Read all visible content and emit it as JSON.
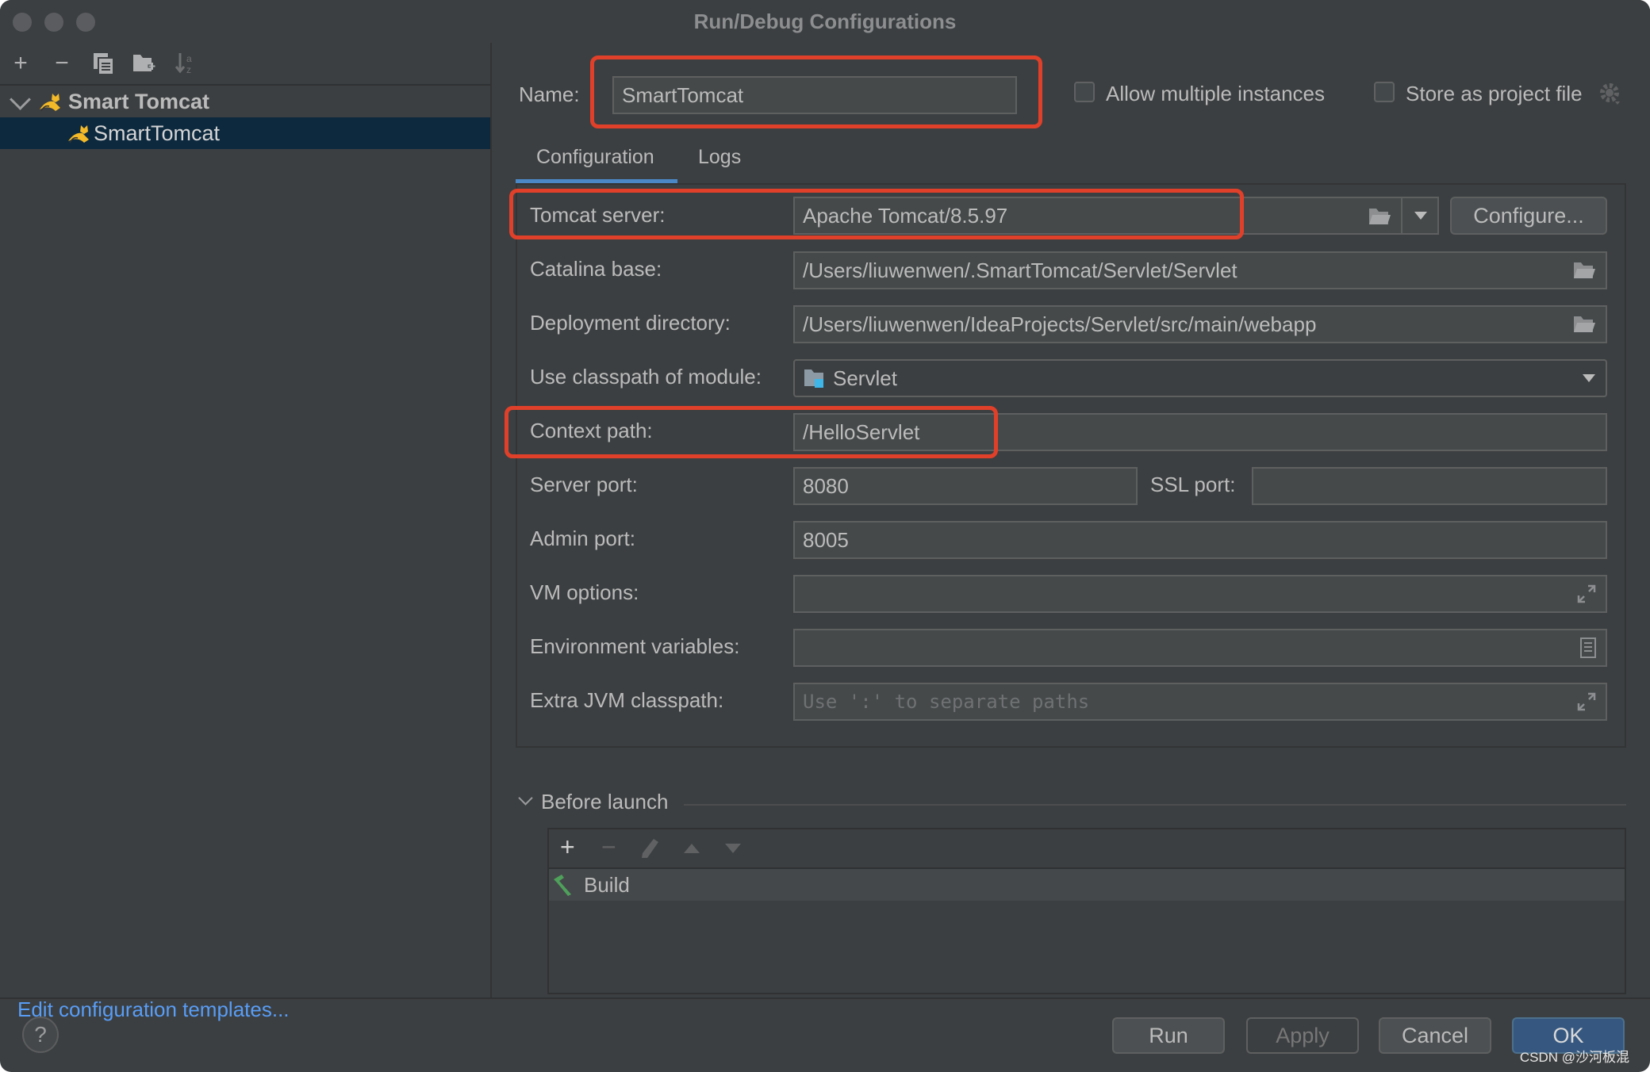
{
  "window": {
    "title": "Run/Debug Configurations"
  },
  "sidebar": {
    "toolbar": {
      "add": "+",
      "remove": "−",
      "copy_icon": "copy-icon",
      "folder_icon": "new-folder-icon",
      "sort_icon": "sort-alpha-icon"
    },
    "tree": [
      {
        "label": "Smart Tomcat",
        "expanded": true,
        "icon": "tomcat-icon"
      },
      {
        "label": "SmartTomcat",
        "selected": true,
        "icon": "tomcat-icon"
      }
    ],
    "edit_templates_link": "Edit configuration templates..."
  },
  "header": {
    "name_label": "Name:",
    "name_value": "SmartTomcat",
    "allow_multiple_label": "Allow multiple instances",
    "allow_multiple_checked": false,
    "store_project_label": "Store as project file",
    "store_project_checked": false
  },
  "tabs": [
    {
      "label": "Configuration",
      "active": true
    },
    {
      "label": "Logs",
      "active": false
    }
  ],
  "form": {
    "tomcat_server": {
      "label": "Tomcat server:",
      "value": "Apache Tomcat/8.5.97",
      "configure_button": "Configure..."
    },
    "catalina_base": {
      "label": "Catalina base:",
      "value": "/Users/liuwenwen/.SmartTomcat/Servlet/Servlet"
    },
    "deployment_directory": {
      "label": "Deployment directory:",
      "value": "/Users/liuwenwen/IdeaProjects/Servlet/src/main/webapp"
    },
    "classpath_module": {
      "label": "Use classpath of module:",
      "value": "Servlet"
    },
    "context_path": {
      "label": "Context path:",
      "value": "/HelloServlet"
    },
    "server_port": {
      "label": "Server port:",
      "value": "8080"
    },
    "ssl_port": {
      "label": "SSL port:",
      "value": ""
    },
    "admin_port": {
      "label": "Admin port:",
      "value": "8005"
    },
    "vm_options": {
      "label": "VM options:",
      "value": ""
    },
    "env_variables": {
      "label": "Environment variables:",
      "value": ""
    },
    "extra_jvm_classpath": {
      "label": "Extra JVM classpath:",
      "value": "",
      "placeholder": "Use ':' to separate paths"
    }
  },
  "before_launch": {
    "title": "Before launch",
    "tasks": [
      {
        "label": "Build",
        "icon": "hammer-icon"
      }
    ]
  },
  "footer": {
    "help": "?",
    "run": "Run",
    "apply": "Apply",
    "cancel": "Cancel",
    "ok": "OK"
  },
  "colors": {
    "highlight_box": "#e0402a",
    "link": "#589df6",
    "primary_button": "#365880",
    "selection": "#0d293e"
  },
  "watermark": "CSDN @沙河板混"
}
